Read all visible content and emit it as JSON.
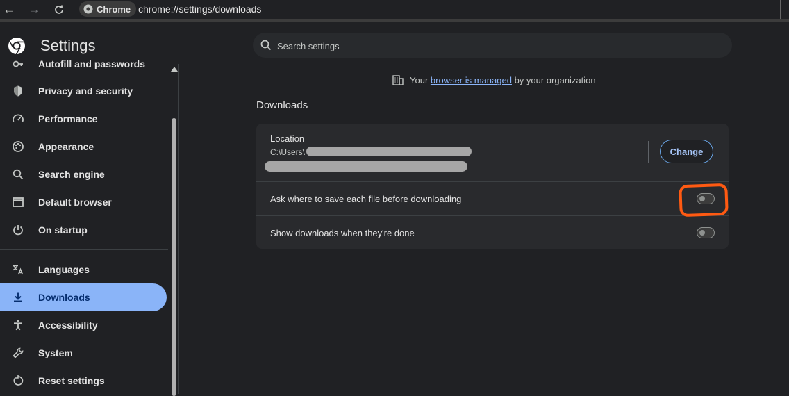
{
  "browser": {
    "chip_label": "Chrome",
    "url": "chrome://settings/downloads"
  },
  "header": {
    "title": "Settings"
  },
  "search": {
    "placeholder": "Search settings"
  },
  "managed": {
    "prefix": "Your ",
    "link": "browser is managed",
    "suffix": " by your organization"
  },
  "sidebar": {
    "items": [
      {
        "label": "Autofill and passwords",
        "icon": "key-icon"
      },
      {
        "label": "Privacy and security",
        "icon": "shield-icon"
      },
      {
        "label": "Performance",
        "icon": "speedometer-icon"
      },
      {
        "label": "Appearance",
        "icon": "palette-icon"
      },
      {
        "label": "Search engine",
        "icon": "search-icon"
      },
      {
        "label": "Default browser",
        "icon": "browser-window-icon"
      },
      {
        "label": "On startup",
        "icon": "power-icon"
      },
      {
        "label": "Languages",
        "icon": "translate-icon"
      },
      {
        "label": "Downloads",
        "icon": "download-icon",
        "active": true
      },
      {
        "label": "Accessibility",
        "icon": "accessibility-icon"
      },
      {
        "label": "System",
        "icon": "wrench-icon"
      },
      {
        "label": "Reset settings",
        "icon": "reset-icon"
      }
    ]
  },
  "downloads": {
    "section_title": "Downloads",
    "location_label": "Location",
    "location_path_visible": "C:\\Users\\",
    "change_label": "Change",
    "ask_where_label": "Ask where to save each file before downloading",
    "ask_where_enabled": false,
    "show_when_done_label": "Show downloads when they're done",
    "show_when_done_enabled": false
  },
  "colors": {
    "accent": "#8ab4f8",
    "highlight": "#ff5a12",
    "background": "#202124",
    "card": "#292a2d"
  }
}
